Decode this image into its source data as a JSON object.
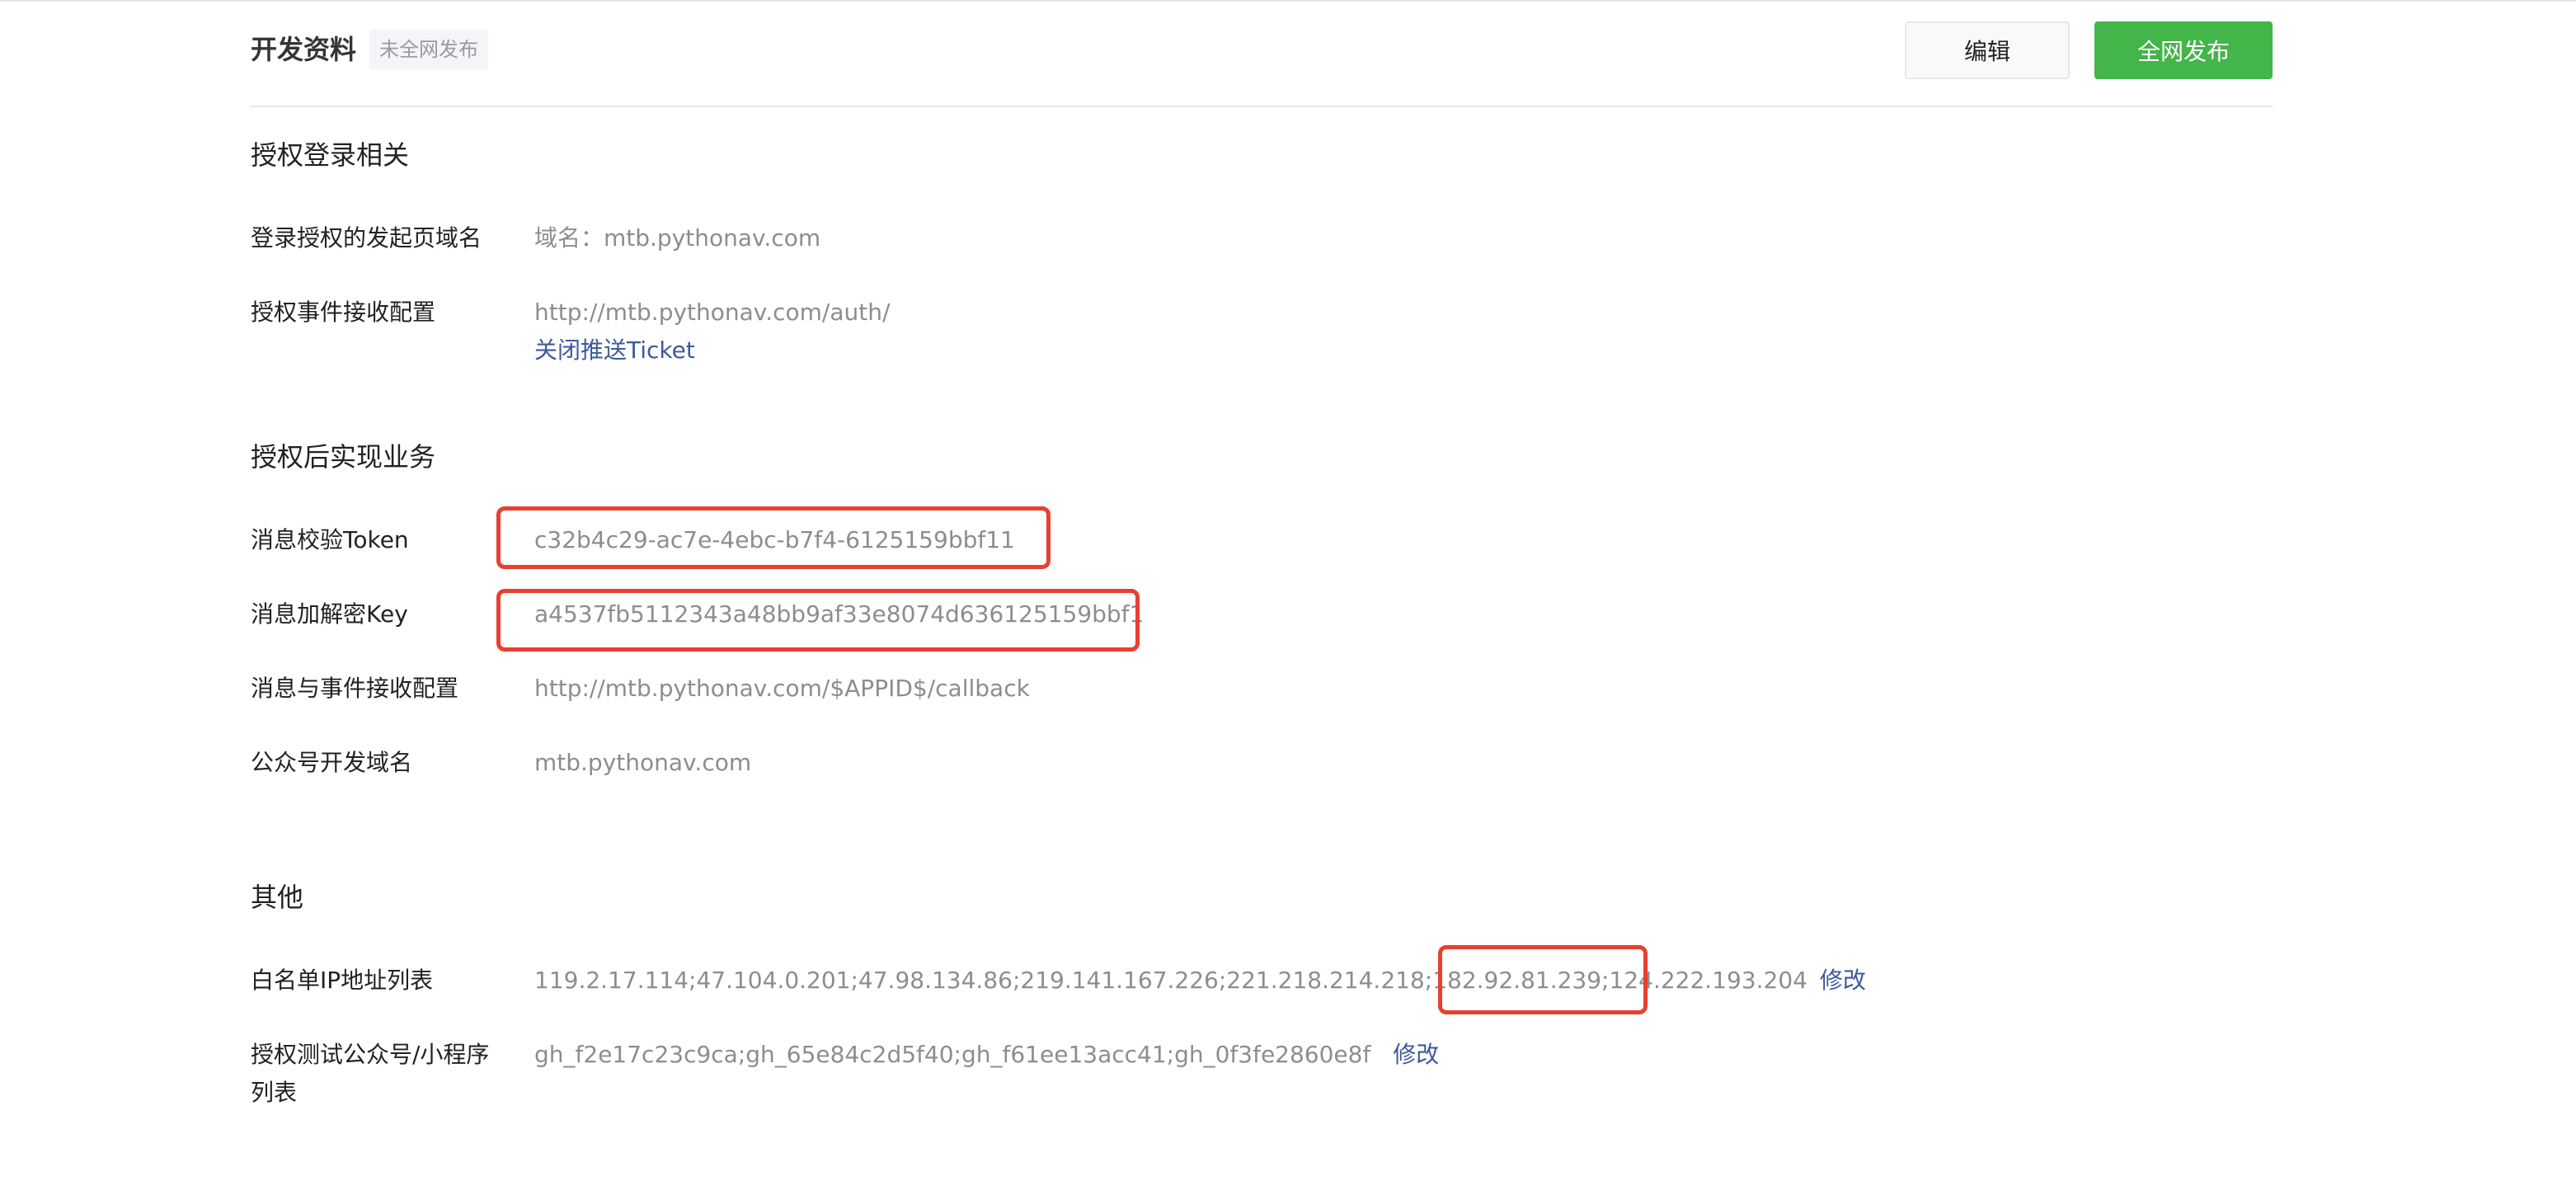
{
  "header": {
    "title": "开发资料",
    "status_badge": "未全网发布",
    "edit_label": "编辑",
    "publish_label": "全网发布"
  },
  "auth_login": {
    "section_title": "授权登录相关",
    "domain_label": "登录授权的发起页域名",
    "domain_value": "域名：mtb.pythonav.com",
    "event_label": "授权事件接收配置",
    "event_value": "http://mtb.pythonav.com/auth/",
    "event_link": "关闭推送Ticket"
  },
  "auth_business": {
    "section_title": "授权后实现业务",
    "token_label": "消息校验Token",
    "token_value": "c32b4c29-ac7e-4ebc-b7f4-6125159bbf11",
    "key_label": "消息加解密Key",
    "key_value": "a4537fb5112343a48bb9af33e8074d636125159bbf1",
    "msg_label": "消息与事件接收配置",
    "msg_value": "http://mtb.pythonav.com/$APPID$/callback",
    "mp_domain_label": "公众号开发域名",
    "mp_domain_value": "mtb.pythonav.com"
  },
  "other": {
    "section_title": "其他",
    "whitelist_label": "白名单IP地址列表",
    "whitelist_value_main": "119.2.17.114;47.104.0.201;47.98.134.86;219.141.167.226;221.218.214.218;182.92.81.239;",
    "whitelist_value_highlight": "124.222.193.204",
    "whitelist_edit": "修改",
    "test_label": "授权测试公众号/小程序列表",
    "test_value": "gh_f2e17c23c9ca;gh_65e84c2d5f40;gh_f61ee13acc41;gh_0f3fe2860e8f",
    "test_edit": "修改"
  },
  "colors": {
    "accent_green": "#44b549",
    "link_blue": "#3c5a9a",
    "highlight_red": "#e8402f"
  }
}
